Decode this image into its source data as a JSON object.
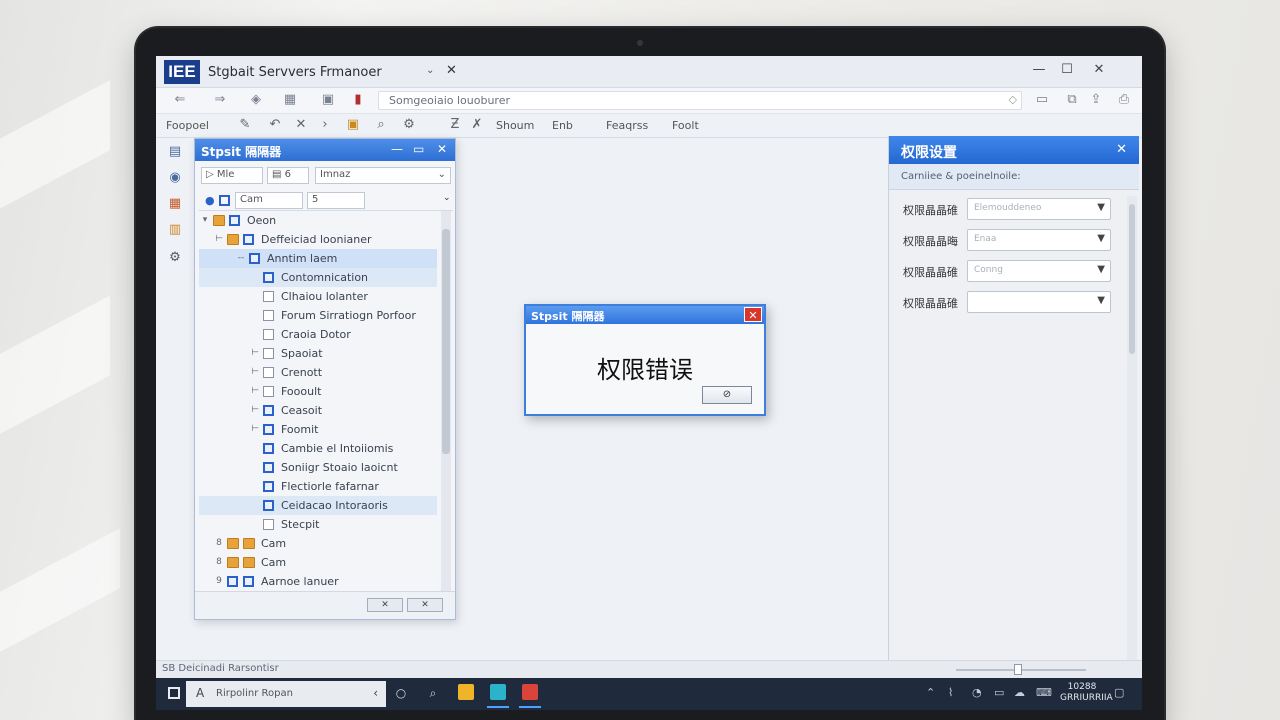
{
  "window": {
    "logo_text": "IEE",
    "title": "Stgbait Servvers Frmanoer",
    "tab_chevron": "⌄",
    "tab_close": "✕",
    "minimize": "—",
    "maximize": "☐",
    "close": "✕"
  },
  "nav": {
    "back": "⇐",
    "forward": "⇒",
    "address": "Somgeoiaio louoburer",
    "address_icon": "◇"
  },
  "toolbar": {
    "first_label": "Foopoel",
    "items": [
      "Shoum",
      "Enb",
      "Feaqrss",
      "Foolt"
    ]
  },
  "tree_window": {
    "title": "Stpsit 隔隔器",
    "view_label": "Mle",
    "page_value": "6",
    "filter_value": "Imnaz",
    "search_value": "Cam",
    "search_page": "5",
    "rows": [
      {
        "label": "Oeon",
        "kind": "folder",
        "expander": "▾"
      },
      {
        "label": "Deffeiciad loonianer",
        "kind": "folder",
        "expander": "⊢"
      },
      {
        "label": "Anntim laem",
        "kind": "checkon",
        "expander": "--"
      },
      {
        "label": "Contomnication",
        "kind": "checkon",
        "expander": ""
      },
      {
        "label": "Clhaiou lolanter",
        "kind": "check",
        "expander": ""
      },
      {
        "label": "Forum Sirratiogn Porfoor",
        "kind": "check",
        "expander": ""
      },
      {
        "label": "Craoia Dotor",
        "kind": "check",
        "expander": ""
      },
      {
        "label": "Spaoiat",
        "kind": "check",
        "expander": "⊢"
      },
      {
        "label": "Crenott",
        "kind": "check",
        "expander": "⊢"
      },
      {
        "label": "Foooult",
        "kind": "check",
        "expander": "⊢"
      },
      {
        "label": "Ceasoit",
        "kind": "checkon",
        "expander": "⊢"
      },
      {
        "label": "Foomit",
        "kind": "checkon",
        "expander": "⊢"
      },
      {
        "label": "Cambie el Intoiiomis",
        "kind": "checkon",
        "expander": ""
      },
      {
        "label": "Soniigr Stoaio laoicnt",
        "kind": "checkon",
        "expander": ""
      },
      {
        "label": "Flectiorle fafarnar",
        "kind": "checkon",
        "expander": ""
      },
      {
        "label": "Ceidacao Intoraoris",
        "kind": "checkon",
        "expander": ""
      },
      {
        "label": "Stecpit",
        "kind": "check",
        "expander": ""
      },
      {
        "label": "Cam",
        "kind": "folder",
        "expander": "8"
      },
      {
        "label": "Cam",
        "kind": "folder",
        "expander": "8"
      },
      {
        "label": "Aarnoe lanuer",
        "kind": "checkon",
        "expander": "9"
      }
    ],
    "footer_btn1": "✕",
    "footer_btn2": "✕"
  },
  "dialog": {
    "title": "Stpsit 隔隔器",
    "close_label": "✕",
    "message": "权限错误",
    "ok_label": "⊘"
  },
  "perm_panel": {
    "title": "权限设置",
    "close": "✕",
    "subtitle": "Carniiee & poeinelnoile:",
    "rows": [
      {
        "label": "权限晶晶碓",
        "value": "Elemouddeneo"
      },
      {
        "label": "权限晶晶晦",
        "value": "Enaa"
      },
      {
        "label": "权限晶晶碓",
        "value": "Conng"
      },
      {
        "label": "权限晶晶碓",
        "value": ""
      }
    ]
  },
  "status": {
    "text": "SB Deicinadi  Rarsontisr"
  },
  "taskbar": {
    "search_text": "Rirpolinr Ropan",
    "clock": "10288\nGRRIURRIIA"
  }
}
